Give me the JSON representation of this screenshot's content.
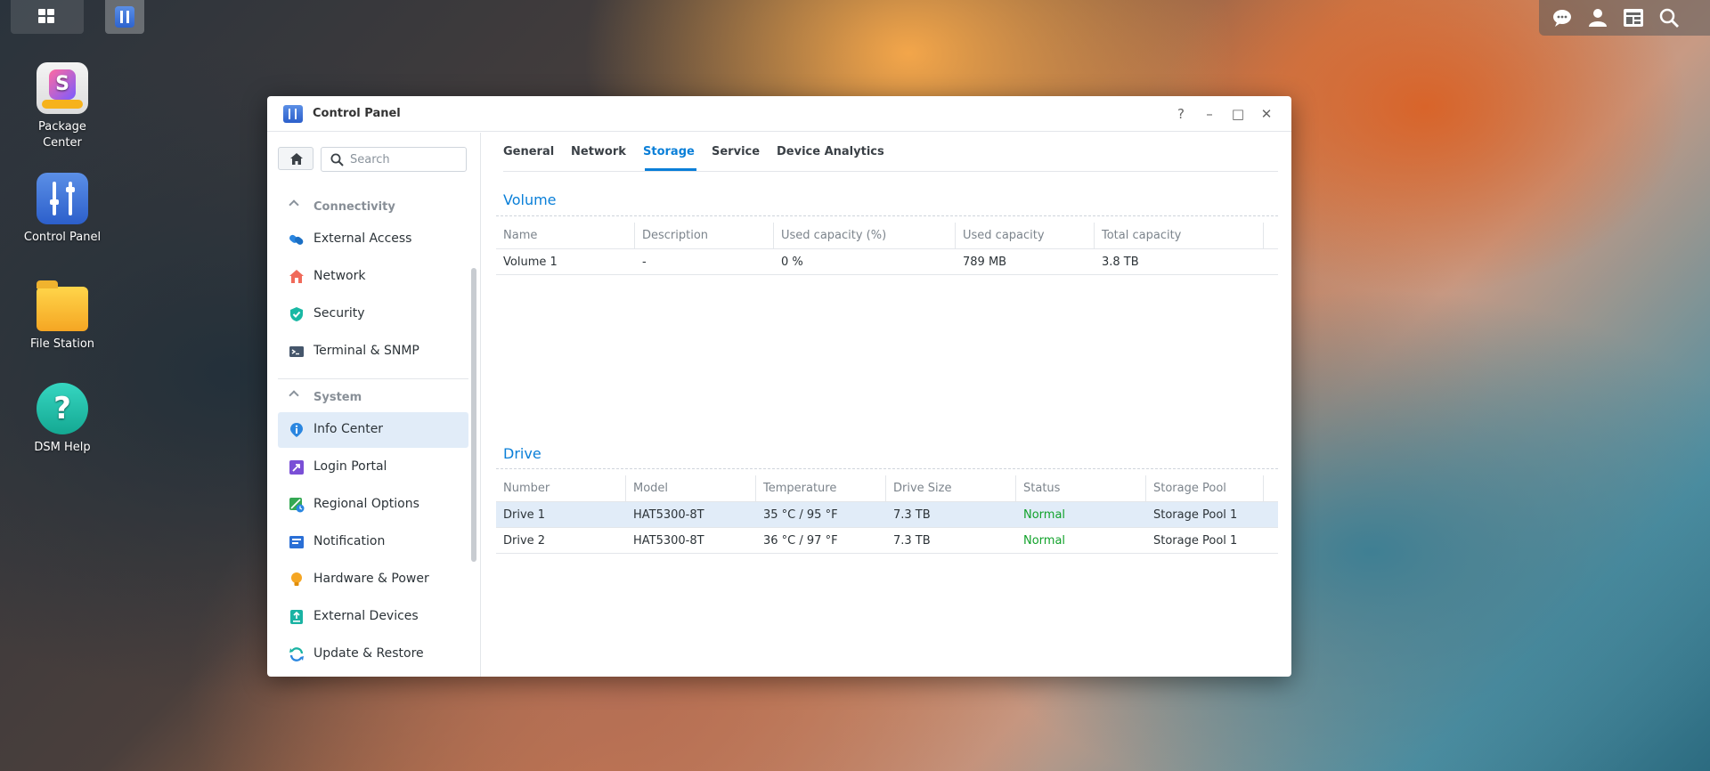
{
  "desktop": {
    "icons": [
      {
        "name": "package-center",
        "label": "Package Center"
      },
      {
        "name": "control-panel",
        "label": "Control Panel"
      },
      {
        "name": "file-station",
        "label": "File Station"
      },
      {
        "name": "dsm-help",
        "label": "DSM Help"
      }
    ]
  },
  "window": {
    "title": "Control Panel",
    "controls": {
      "help": "?",
      "minimize": "–",
      "maximize": "□",
      "close": "✕"
    }
  },
  "sidebar": {
    "search_placeholder": "Search",
    "sections": [
      {
        "label": "Connectivity",
        "items": [
          {
            "label": "External Access",
            "icon": "link-icon"
          },
          {
            "label": "Network",
            "icon": "house-network-icon"
          },
          {
            "label": "Security",
            "icon": "shield-icon"
          },
          {
            "label": "Terminal & SNMP",
            "icon": "terminal-icon"
          }
        ]
      },
      {
        "label": "System",
        "items": [
          {
            "label": "Info Center",
            "icon": "info-icon"
          },
          {
            "label": "Login Portal",
            "icon": "login-portal-icon"
          },
          {
            "label": "Regional Options",
            "icon": "globe-clock-icon"
          },
          {
            "label": "Notification",
            "icon": "notification-icon"
          },
          {
            "label": "Hardware & Power",
            "icon": "bulb-icon"
          },
          {
            "label": "External Devices",
            "icon": "external-device-icon"
          },
          {
            "label": "Update & Restore",
            "icon": "refresh-icon"
          }
        ]
      }
    ],
    "active": "Info Center"
  },
  "tabs": [
    {
      "label": "General"
    },
    {
      "label": "Network"
    },
    {
      "label": "Storage"
    },
    {
      "label": "Service"
    },
    {
      "label": "Device Analytics"
    }
  ],
  "active_tab": "Storage",
  "volume": {
    "title": "Volume",
    "columns": [
      "Name",
      "Description",
      "Used capacity (%)",
      "Used capacity",
      "Total capacity"
    ],
    "rows": [
      [
        "Volume 1",
        "-",
        "0 %",
        "789 MB",
        "3.8 TB"
      ]
    ]
  },
  "drive": {
    "title": "Drive",
    "columns": [
      "Number",
      "Model",
      "Temperature",
      "Drive Size",
      "Status",
      "Storage Pool"
    ],
    "rows": [
      [
        "Drive 1",
        "HAT5300-8T",
        "35 °C / 95 °F",
        "7.3 TB",
        "Normal",
        "Storage Pool 1"
      ],
      [
        "Drive 2",
        "HAT5300-8T",
        "36 °C / 97 °F",
        "7.3 TB",
        "Normal",
        "Storage Pool 1"
      ]
    ]
  },
  "colors": {
    "accent": "#0a7fd8",
    "status_normal": "#11a22b",
    "selected_row": "#e1ecf8"
  }
}
